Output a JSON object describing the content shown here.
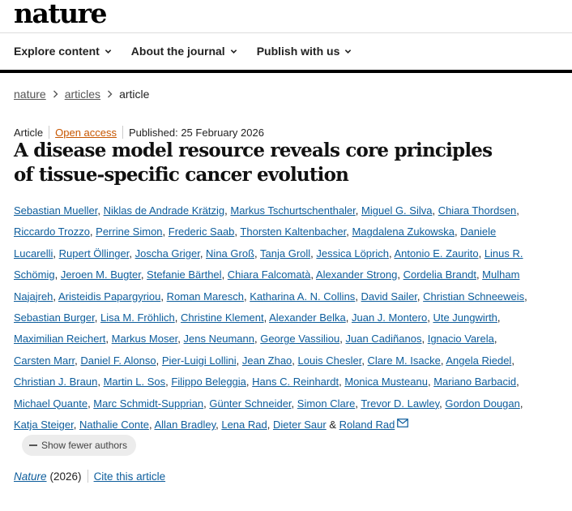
{
  "site": {
    "logo": "nature"
  },
  "nav": {
    "items": [
      {
        "label": "Explore content"
      },
      {
        "label": "About the journal"
      },
      {
        "label": "Publish with us"
      }
    ]
  },
  "breadcrumb": {
    "items": [
      "nature",
      "articles"
    ],
    "current": "article"
  },
  "meta": {
    "type": "Article",
    "access": "Open access",
    "published": "Published: 25 February 2026"
  },
  "article": {
    "title": "A disease model resource reveals core principles of tissue-specific cancer evolution"
  },
  "authors": [
    "Sebastian Mueller",
    "Niklas de Andrade Krätzig",
    "Markus Tschurtschenthaler",
    "Miguel G. Silva",
    "Chiara Thordsen",
    "Riccardo Trozzo",
    "Perrine Simon",
    "Frederic Saab",
    "Thorsten Kaltenbacher",
    "Magdalena Zukowska",
    "Daniele Lucarelli",
    "Rupert Öllinger",
    "Joscha Griger",
    "Nina Groß",
    "Tanja Groll",
    "Jessica Löprich",
    "Antonio E. Zaurito",
    "Linus R. Schömig",
    "Jeroen M. Bugter",
    "Stefanie Bärthel",
    "Chiara Falcomatà",
    "Alexander Strong",
    "Cordelia Brandt",
    "Mulham Najajreh",
    "Aristeidis Papargyriou",
    "Roman Maresch",
    "Katharina A. N. Collins",
    "David Sailer",
    "Christian Schneeweis",
    "Sebastian Burger",
    "Lisa M. Fröhlich",
    "Christine Klement",
    "Alexander Belka",
    "Juan J. Montero",
    "Ute Jungwirth",
    "Maximilian Reichert",
    "Markus Moser",
    "Jens Neumann",
    "George Vassiliou",
    "Juan Cadiñanos",
    "Ignacio Varela",
    "Carsten Marr",
    "Daniel F. Alonso",
    "Pier-Luigi Lollini",
    "Jean Zhao",
    "Louis Chesler",
    "Clare M. Isacke",
    "Angela Riedel",
    "Christian J. Braun",
    "Martin L. Sos",
    "Filippo Beleggia",
    "Hans C. Reinhardt",
    "Monica Musteanu",
    "Mariano Barbacid",
    "Michael Quante",
    "Marc Schmidt-Supprian",
    "Günter Schneider",
    "Simon Clare",
    "Trevor D. Lawley",
    "Gordon Dougan",
    "Katja Steiger",
    "Nathalie Conte",
    "Allan Bradley",
    "Lena Rad",
    "Dieter Saur",
    "Roland Rad"
  ],
  "authors_and": "&",
  "show_fewer": {
    "label": "Show fewer authors"
  },
  "citation": {
    "journal": "Nature",
    "year": "(2026)",
    "cite_label": "Cite this article"
  }
}
